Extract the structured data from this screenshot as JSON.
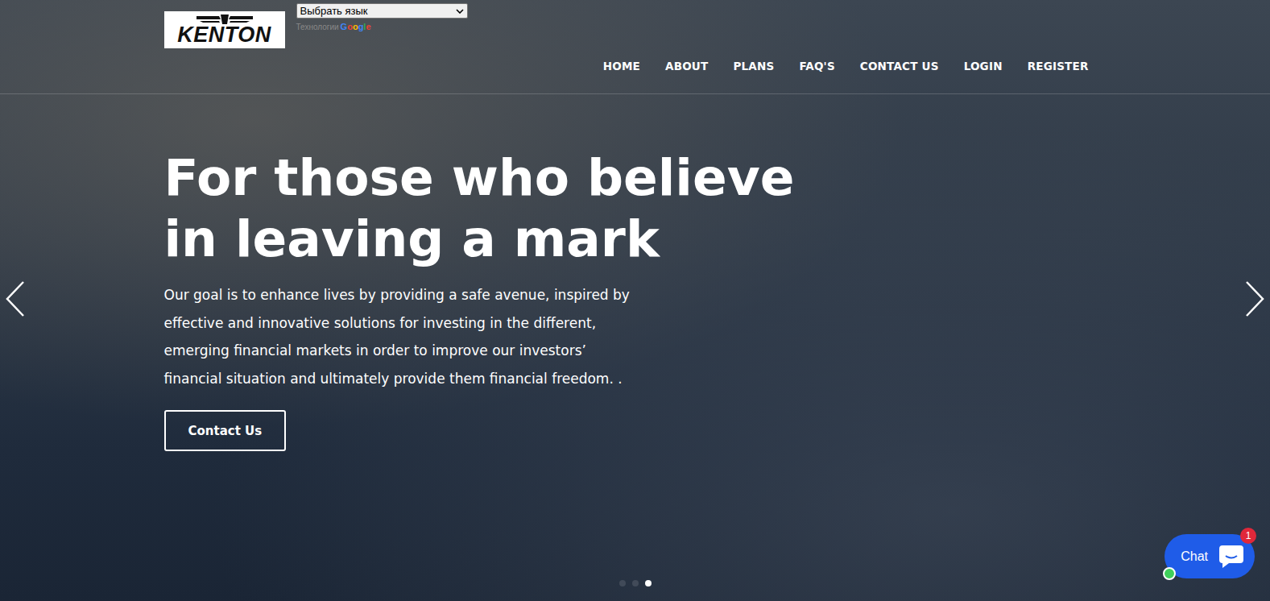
{
  "logo": {
    "text": "KENTON"
  },
  "translate": {
    "select": "Выбрать язык",
    "powered_by": "Технологии",
    "brand": "Google"
  },
  "nav": [
    {
      "label": "HOME"
    },
    {
      "label": "ABOUT"
    },
    {
      "label": "PLANS"
    },
    {
      "label": "FAQ'S"
    },
    {
      "label": "CONTACT US"
    },
    {
      "label": "LOGIN"
    },
    {
      "label": "REGISTER"
    }
  ],
  "hero": {
    "title_lines": [
      "For those who believe",
      "in leaving a mark"
    ],
    "text": "Our goal is to enhance lives by providing a safe avenue, inspired by effective and innovative solutions for investing in the different, emerging financial markets in order to improve our investors’ financial situation and ultimately provide them financial freedom. .",
    "button": "Contact Us"
  },
  "slider_dots": [
    {
      "selected": false
    },
    {
      "selected": false
    },
    {
      "selected": true
    }
  ],
  "chat": {
    "label": "Chat",
    "badge": "1",
    "online": true
  }
}
